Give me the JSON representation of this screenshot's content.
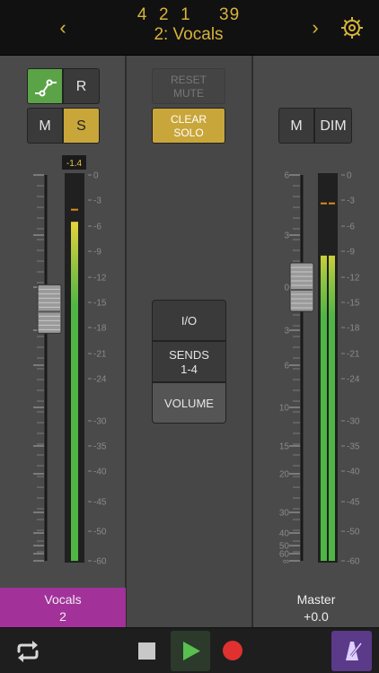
{
  "header": {
    "position": "4  2  1     39",
    "track_title": "2: Vocals",
    "prev_icon": "chevron-left-icon",
    "next_icon": "chevron-right-icon",
    "settings_icon": "gear-icon",
    "accent_color": "#d6b33a"
  },
  "left_strip": {
    "automation_icon": "automation-curve-icon",
    "read_label": "R",
    "mute_label": "M",
    "solo_label": "S",
    "peak_readout": "-1.4",
    "fader_level_db": -1.4,
    "meter_level_db": -5.5,
    "peak_hold_db": -4,
    "name": "Vocals",
    "number": "2",
    "color": "#a2319a"
  },
  "middle": {
    "reset_mute_label": "RESET\nMUTE",
    "clear_solo_label": "CLEAR\nSOLO",
    "io_label": "I/O",
    "sends_label": "SENDS\n1-4",
    "volume_label": "VOLUME"
  },
  "right_strip": {
    "mute_label": "M",
    "dim_label": "DIM",
    "fader_level_db": 0,
    "meter_level_db": -9.5,
    "peak_hold_db": -4,
    "name": "Master",
    "value": "+0.0"
  },
  "meter_scale": [
    "0",
    "-3",
    "-6",
    "-9",
    "-12",
    "-15",
    "-18",
    "-21",
    "-24",
    "-30",
    "-35",
    "-40",
    "-45",
    "-50",
    "-60"
  ],
  "fader_scale": [
    "6",
    "3",
    "0",
    "3",
    "6",
    "10",
    "15",
    "20",
    "30",
    "40",
    "50",
    "60",
    "∞"
  ],
  "transport": {
    "loop_icon": "loop-icon",
    "stop_icon": "stop-icon",
    "play_icon": "play-icon",
    "record_icon": "record-icon",
    "metronome_icon": "metronome-icon"
  }
}
